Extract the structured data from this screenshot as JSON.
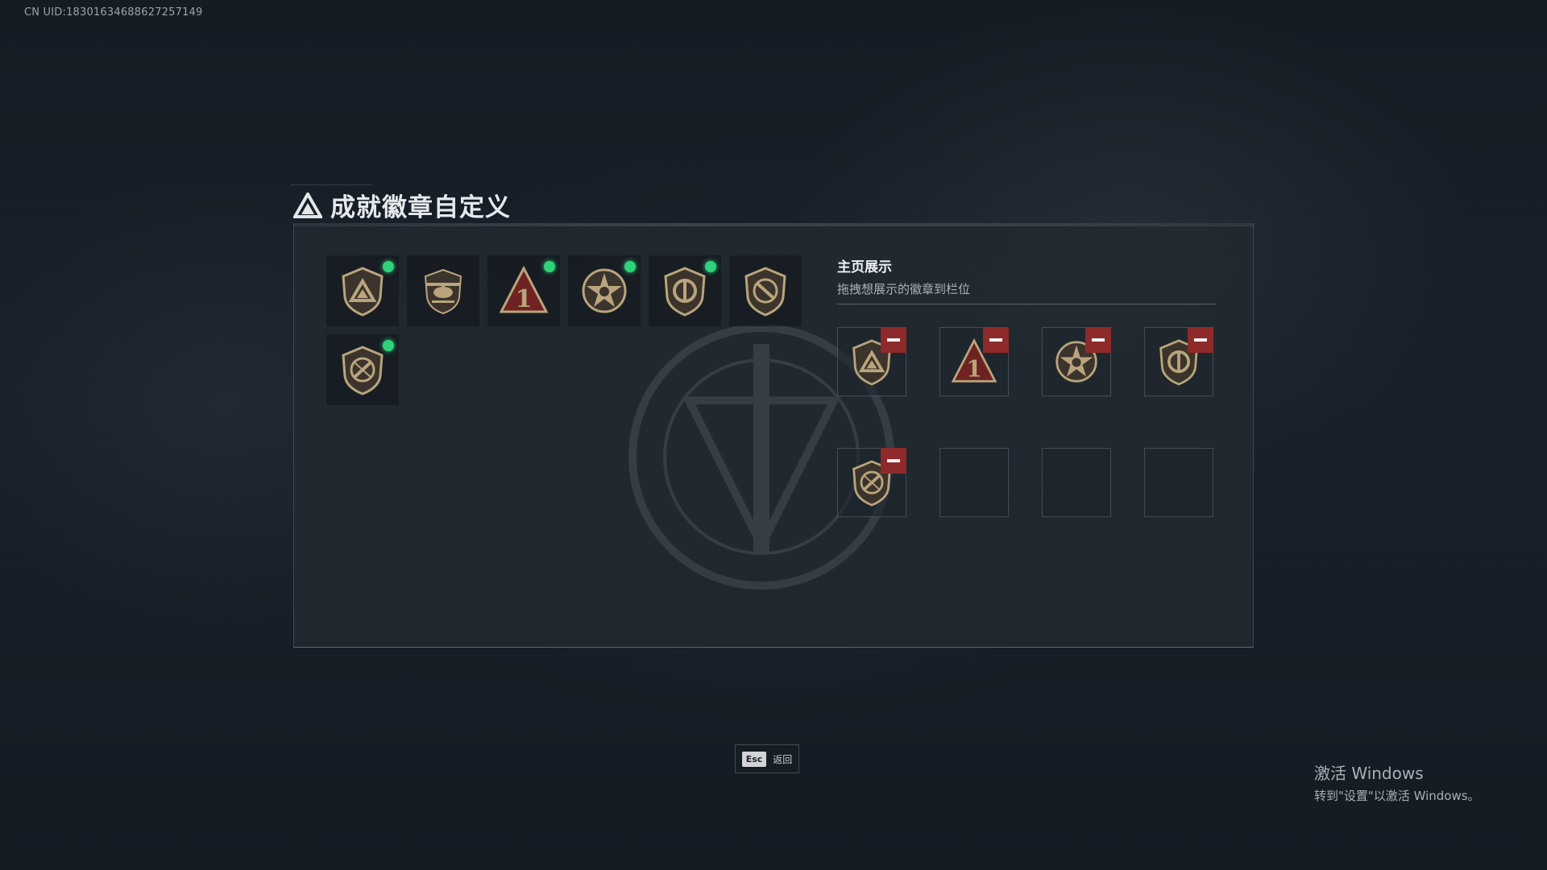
{
  "uid": "CN UID:18301634688627257149",
  "title": "成就徽章自定义",
  "showcase": {
    "title": "主页展示",
    "subtitle": "拖拽想展示的徽章到栏位"
  },
  "badges": [
    {
      "icon": "shield-triangle-badge-icon",
      "new": true
    },
    {
      "icon": "helicopter-badge-icon",
      "new": false
    },
    {
      "icon": "rank-one-badge-icon",
      "new": true
    },
    {
      "icon": "star-badge-icon",
      "new": true
    },
    {
      "icon": "emblem-shield-badge-icon",
      "new": true
    },
    {
      "icon": "no-sniper-badge-icon",
      "new": false
    },
    {
      "icon": "crossed-shield-badge-icon",
      "new": true
    }
  ],
  "slots": [
    {
      "icon": "shield-triangle-badge-icon",
      "filled": true
    },
    {
      "icon": "rank-one-badge-icon",
      "filled": true
    },
    {
      "icon": "star-badge-icon",
      "filled": true
    },
    {
      "icon": "emblem-shield-badge-icon",
      "filled": true
    },
    {
      "icon": "crossed-shield-badge-icon",
      "filled": true
    },
    {
      "icon": "",
      "filled": false
    },
    {
      "icon": "",
      "filled": false
    },
    {
      "icon": "",
      "filled": false
    }
  ],
  "esc": {
    "key": "Esc",
    "label": "返回"
  },
  "activation": {
    "line1": "激活 Windows",
    "line2": "转到\"设置\"以激活 Windows。"
  },
  "colors": {
    "new_dot": "#2fd27a",
    "remove": "#8e2a2a",
    "accent": "#a9b5bf"
  }
}
